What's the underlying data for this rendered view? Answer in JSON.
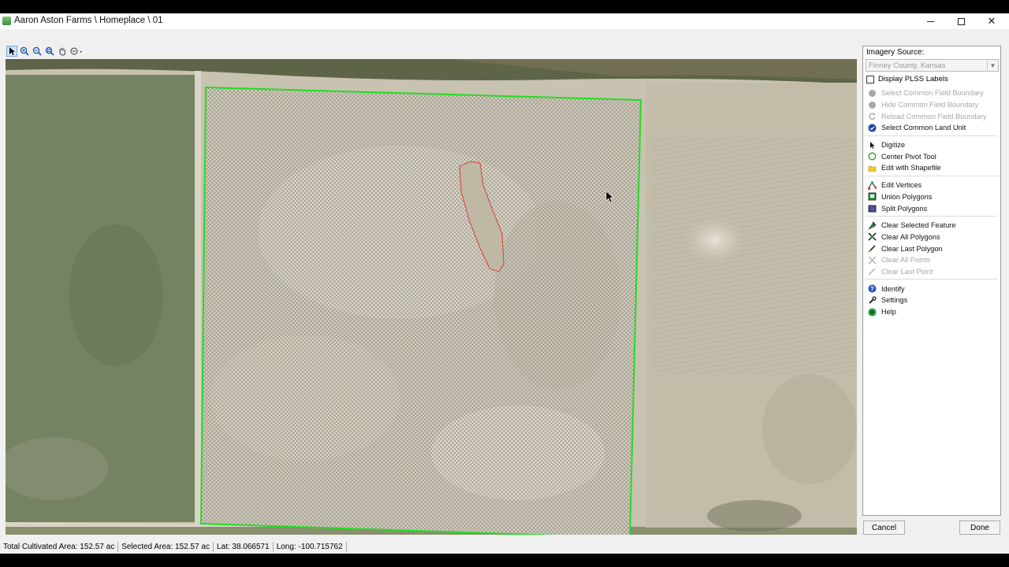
{
  "window": {
    "title": "Aaron Aston Farms \\ Homeplace \\ 01",
    "controls": {
      "minimize": "minimize-icon",
      "maximize": "maximize-icon",
      "close": "close-icon"
    }
  },
  "toolbar": {
    "tools": [
      "pointer-icon",
      "zoom-in-icon",
      "zoom-out-icon",
      "zoom-extent-icon",
      "pan-hand-icon",
      "measure-dropdown-icon"
    ],
    "active": "pointer-icon"
  },
  "map": {
    "field_boundary_color": "#22dd22",
    "exclusion_boundary_color": "#e03030",
    "hatch_color": "#6a6a6a"
  },
  "panel": {
    "imagery_label": "Imagery Source:",
    "imagery_value": "Finney County, Kansas",
    "plss_label": "Display PLSS Labels",
    "plss_checked": false,
    "groups": [
      [
        {
          "label": "Select Common Field Boundary",
          "icon": "gray-circle-icon",
          "enabled": false
        },
        {
          "label": "Hide Common Field Boundary",
          "icon": "gray-circle-icon",
          "enabled": false
        },
        {
          "label": "Reload Common Field Boundary",
          "icon": "reload-icon",
          "enabled": false
        },
        {
          "label": "Select Common Land Unit",
          "icon": "blue-check-icon",
          "enabled": true
        }
      ],
      [
        {
          "label": "Digitize",
          "icon": "digitize-icon",
          "enabled": true
        },
        {
          "label": "Center Pivot Tool",
          "icon": "green-circle-icon",
          "enabled": true
        },
        {
          "label": "Edit with Shapefile",
          "icon": "folder-icon",
          "enabled": true
        }
      ],
      [
        {
          "label": "Edit Vertices",
          "icon": "edit-vertices-icon",
          "enabled": true
        },
        {
          "label": "Union Polygons",
          "icon": "union-icon",
          "enabled": true
        },
        {
          "label": "Split Polygons",
          "icon": "split-icon",
          "enabled": true
        }
      ],
      [
        {
          "label": "Clear Selected Feature",
          "icon": "clear-selected-icon",
          "enabled": true
        },
        {
          "label": "Clear All Polygons",
          "icon": "clear-all-icon",
          "enabled": true
        },
        {
          "label": "Clear Last Polygon",
          "icon": "clear-last-icon",
          "enabled": true
        },
        {
          "label": "Clear All Points",
          "icon": "clear-points-icon",
          "enabled": false
        },
        {
          "label": "Clear Last Point",
          "icon": "clear-last-point-icon",
          "enabled": false
        }
      ],
      [
        {
          "label": "Identify",
          "icon": "identify-icon",
          "enabled": true
        },
        {
          "label": "Settings",
          "icon": "settings-icon",
          "enabled": true
        },
        {
          "label": "Help",
          "icon": "help-icon",
          "enabled": true
        }
      ]
    ]
  },
  "buttons": {
    "cancel": "Cancel",
    "done": "Done"
  },
  "status": {
    "total_area": "Total Cultivated Area: 152.57 ac",
    "selected_area": "Selected Area: 152.57 ac",
    "lat": "Lat: 38.066571",
    "long": "Long: -100.715762"
  }
}
